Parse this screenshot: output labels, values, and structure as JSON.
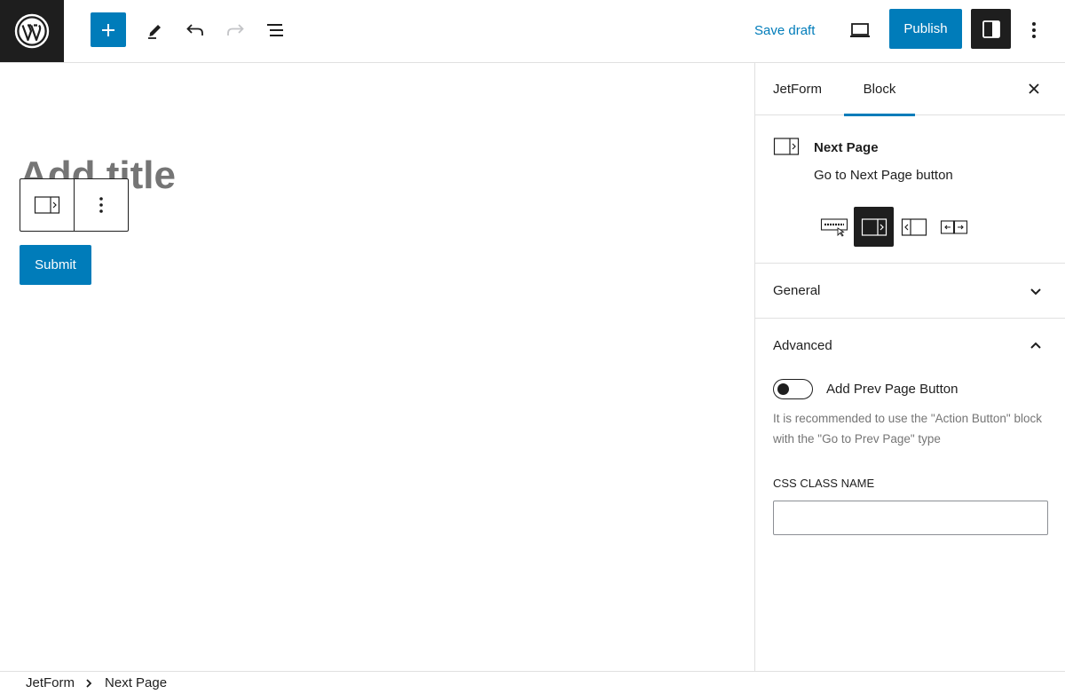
{
  "toolbar": {
    "logo_icon": "wordpress-logo",
    "add_block_icon": "plus-icon",
    "tools_icon": "pencil-icon",
    "undo_icon": "undo-icon",
    "redo_icon": "redo-icon",
    "outline_icon": "list-view-icon",
    "save_draft_label": "Save draft",
    "preview_icon": "laptop-icon",
    "publish_label": "Publish",
    "settings_icon": "sidebar-icon",
    "options_icon": "kebab-icon"
  },
  "editor": {
    "title_placeholder": "Add title",
    "block_toolbar_icon": "next-page-icon",
    "block_toolbar_more_icon": "kebab-icon",
    "submit_label": "Submit"
  },
  "sidebar": {
    "tabs": [
      {
        "label": "JetForm"
      },
      {
        "label": "Block"
      }
    ],
    "active_tab": "Block",
    "block_card": {
      "icon": "next-page-icon",
      "title": "Next Page",
      "description": "Go to Next Page button",
      "variations": [
        "action-button-icon",
        "next-page-icon",
        "prev-page-icon",
        "page-switch-icon"
      ],
      "selected_variation": "next-page-icon"
    },
    "panels": {
      "general": {
        "title": "General",
        "expanded": false
      },
      "advanced": {
        "title": "Advanced",
        "expanded": true,
        "toggle_label": "Add Prev Page Button",
        "toggle_on": false,
        "help_text": "It is recommended to use the \"Action Button\" block with the \"Go to Prev Page\" type",
        "css_class_label": "CSS CLASS NAME",
        "css_class_value": ""
      }
    }
  },
  "footer": {
    "breadcrumbs": [
      {
        "label": "JetForm"
      },
      {
        "label": "Next Page"
      }
    ]
  },
  "colors": {
    "accent": "#007cba",
    "dark": "#1e1e1e",
    "muted": "#757575",
    "border": "#e0e0e0"
  }
}
